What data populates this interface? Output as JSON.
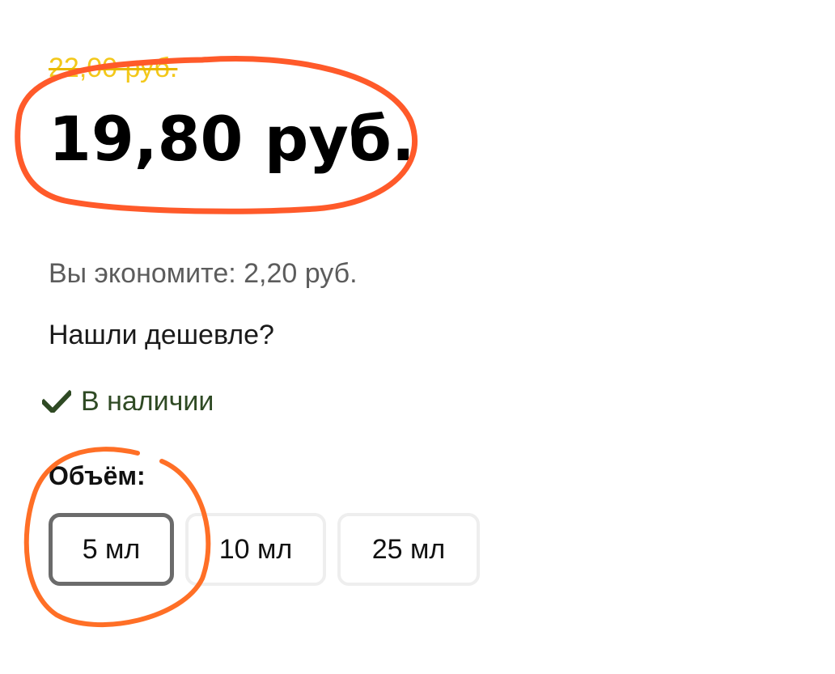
{
  "product": {
    "old_price": "22,00 руб.",
    "new_price": "19,80 руб.",
    "savings": "Вы экономите: 2,20 руб.",
    "cheaper_link": "Нашли дешевле?",
    "availability": "В наличии",
    "volume_label": "Объём:",
    "volume_options": [
      {
        "label": "5 мл",
        "selected": true
      },
      {
        "label": "10 мл",
        "selected": false
      },
      {
        "label": "25 мл",
        "selected": false
      }
    ]
  },
  "colors": {
    "old_price": "#f3c81a",
    "availability": "#2f4a24",
    "annotation_price": "#ff5a2a",
    "annotation_volume": "#ff6f26"
  },
  "icons": {
    "availability": "checkmark-icon"
  }
}
